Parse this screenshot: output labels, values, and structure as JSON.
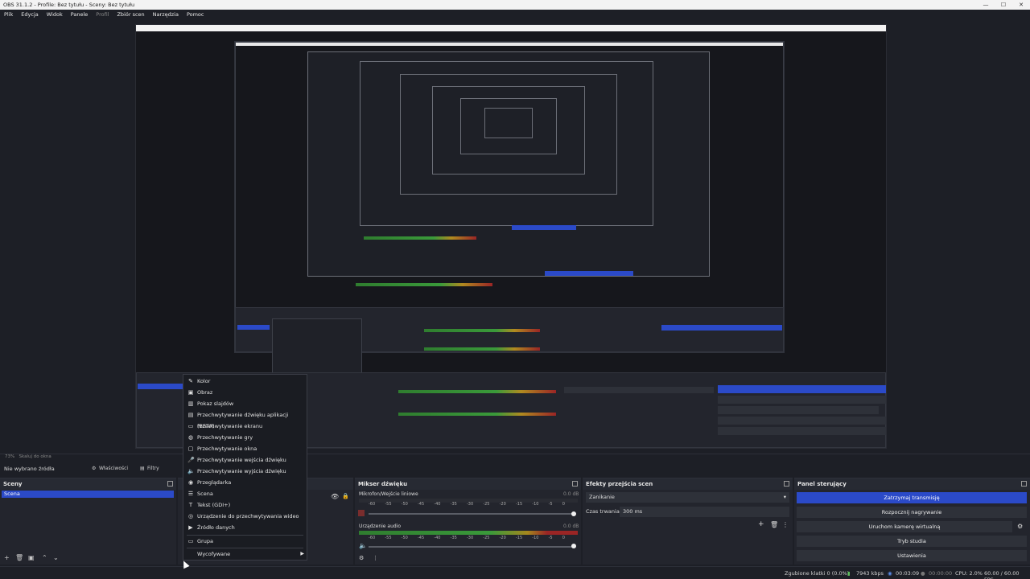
{
  "window": {
    "title": "OBS 31.1.2 - Profile: Bez tytułu - Sceny: Bez tytułu",
    "controls": [
      "—",
      "☐",
      "✕"
    ]
  },
  "menu": [
    "Plik",
    "Edycja",
    "Widok",
    "Panele",
    "Profil",
    "Zbiór scen",
    "Narzędzia",
    "Pomoc"
  ],
  "source_bar": {
    "zoom": "73%",
    "scale_label": "Skaluj do okna",
    "no_source": "Nie wybrano źródła",
    "properties": "Właściwości",
    "filters": "Filtry"
  },
  "scenes": {
    "title": "Sceny",
    "items": [
      "Scena"
    ]
  },
  "mixer": {
    "title": "Mikser dźwięku",
    "scale": [
      "-60",
      "-55",
      "-50",
      "-45",
      "-40",
      "-35",
      "-30",
      "-25",
      "-20",
      "-15",
      "-10",
      "-5",
      "0"
    ],
    "channels": [
      {
        "name": "Mikrofon/Wejście liniowe",
        "db": "0.0 dB"
      },
      {
        "name": "Urządzenie audio",
        "db": "0.0 dB"
      }
    ]
  },
  "transitions": {
    "title": "Efekty przejścia scen",
    "selected": "Zanikanie",
    "duration_label": "Czas trwania",
    "duration": "300 ms"
  },
  "controls": {
    "title": "Panel sterujący",
    "stop_stream": "Zatrzymaj transmisję",
    "start_record": "Rozpocznij nagrywanie",
    "virtual_cam": "Uruchom kamerę wirtualną",
    "studio_mode": "Tryb studia",
    "settings": "Ustawienia"
  },
  "status": {
    "dropped": "Zgubione klatki 0 (0.0%)",
    "kbps": "7943 kbps",
    "stream_time": "00:03:09",
    "rec_time": "00:00:00",
    "cpu": "CPU: 2.0%",
    "fps": "60.00 / 60.00 FPS"
  },
  "context_menu": {
    "items": [
      {
        "label": "Kolor",
        "icon": "color-icon"
      },
      {
        "label": "Obraz",
        "icon": "image-icon"
      },
      {
        "label": "Pokaz slajdów",
        "icon": "slideshow-icon"
      },
      {
        "label": "Przechwytywanie dźwięku aplikacji (BETA)",
        "icon": "app-audio-icon"
      },
      {
        "label": "Przechwytywanie ekranu",
        "icon": "monitor-icon"
      },
      {
        "label": "Przechwytywanie gry",
        "icon": "gamepad-icon"
      },
      {
        "label": "Przechwytywanie okna",
        "icon": "window-icon"
      },
      {
        "label": "Przechwytywanie wejścia dźwięku",
        "icon": "mic-icon"
      },
      {
        "label": "Przechwytywanie wyjścia dźwięku",
        "icon": "speaker-icon"
      },
      {
        "label": "Przeglądarka",
        "icon": "globe-icon"
      },
      {
        "label": "Scena",
        "icon": "list-icon"
      },
      {
        "label": "Tekst (GDI+)",
        "icon": "text-icon"
      },
      {
        "label": "Urządzenie do przechwytywania wideo",
        "icon": "camera-icon"
      },
      {
        "label": "Źródło danych",
        "icon": "media-icon"
      }
    ],
    "group": "Grupa",
    "deprecated": "Wycofywane"
  },
  "colors": {
    "accent": "#2b4ac8",
    "panel": "#23252d",
    "bg": "#1d1f26"
  }
}
